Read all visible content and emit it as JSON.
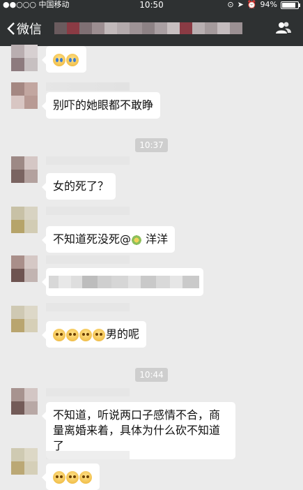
{
  "status_bar": {
    "carrier": "●●○○○ 中国移动",
    "time": "10:50",
    "battery": "94%",
    "battery_level": 0.94
  },
  "nav": {
    "back_label": "微信",
    "group_icon": "group-members-icon"
  },
  "messages": [
    {
      "type": "emoji",
      "emojis": [
        "crying-laughing-emoji",
        "crying-laughing-emoji"
      ]
    },
    {
      "type": "text",
      "text": "别吓的她眼都不敢睁"
    },
    {
      "type": "time",
      "text": "10:37"
    },
    {
      "type": "text",
      "text": "女的死了？"
    },
    {
      "type": "text",
      "text": "不知道死没死@",
      "mention": "洋洋",
      "mention_icon": "flower-avatar-icon"
    },
    {
      "type": "redacted"
    },
    {
      "type": "text",
      "text": "男的呢",
      "prefix_emojis": [
        "pleading-emoji",
        "pleading-emoji",
        "pleading-emoji",
        "pleading-emoji"
      ]
    },
    {
      "type": "time",
      "text": "10:44"
    },
    {
      "type": "text",
      "text": "不知道，听说两口子感情不合，商量离婚来着，具体为什么砍不知道了"
    },
    {
      "type": "emoji",
      "emojis": [
        "pleading-emoji",
        "pleading-emoji",
        "pleading-emoji"
      ]
    }
  ],
  "colors": {
    "nav_bg": "#2e3132",
    "chat_bg": "#ebebeb",
    "bubble_bg": "#ffffff",
    "timestamp_bg": "#cecece"
  }
}
